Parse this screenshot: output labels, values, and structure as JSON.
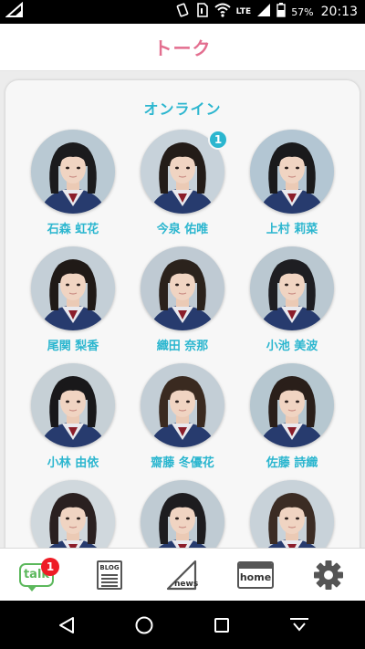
{
  "status_bar": {
    "network": "LTE",
    "battery": "57%",
    "time": "20:13"
  },
  "header": {
    "title": "トーク"
  },
  "section": {
    "title": "オンライン"
  },
  "members": [
    {
      "name": "石森 虹花",
      "badge": ""
    },
    {
      "name": "今泉 佑唯",
      "badge": "1"
    },
    {
      "name": "上村 莉菜",
      "badge": ""
    },
    {
      "name": "尾関 梨香",
      "badge": ""
    },
    {
      "name": "織田 奈那",
      "badge": ""
    },
    {
      "name": "小池 美波",
      "badge": ""
    },
    {
      "name": "小林 由依",
      "badge": ""
    },
    {
      "name": "齋藤 冬優花",
      "badge": ""
    },
    {
      "name": "佐藤 詩織",
      "badge": ""
    },
    {
      "name": "",
      "badge": ""
    },
    {
      "name": "",
      "badge": ""
    },
    {
      "name": "",
      "badge": ""
    }
  ],
  "bottom_nav": {
    "talk_label": "talk",
    "talk_badge": "1",
    "blog_label": "BLOG",
    "news_label": "news",
    "home_label": "home"
  },
  "colors": {
    "accent_pink": "#e36e8f",
    "accent_cyan": "#2bb6cf",
    "talk_green": "#5cb85c",
    "badge_red": "#ee1c25"
  },
  "icons": {
    "status": [
      "notification-icon",
      "vibrate-icon",
      "sim-icon",
      "wifi-icon",
      "signal-icon",
      "battery-icon"
    ],
    "system": [
      "back-icon",
      "home-circle-icon",
      "recents-icon",
      "hide-keyboard-icon"
    ],
    "nav": [
      "talk-icon",
      "blog-icon",
      "news-icon",
      "home-icon",
      "settings-gear-icon"
    ]
  }
}
